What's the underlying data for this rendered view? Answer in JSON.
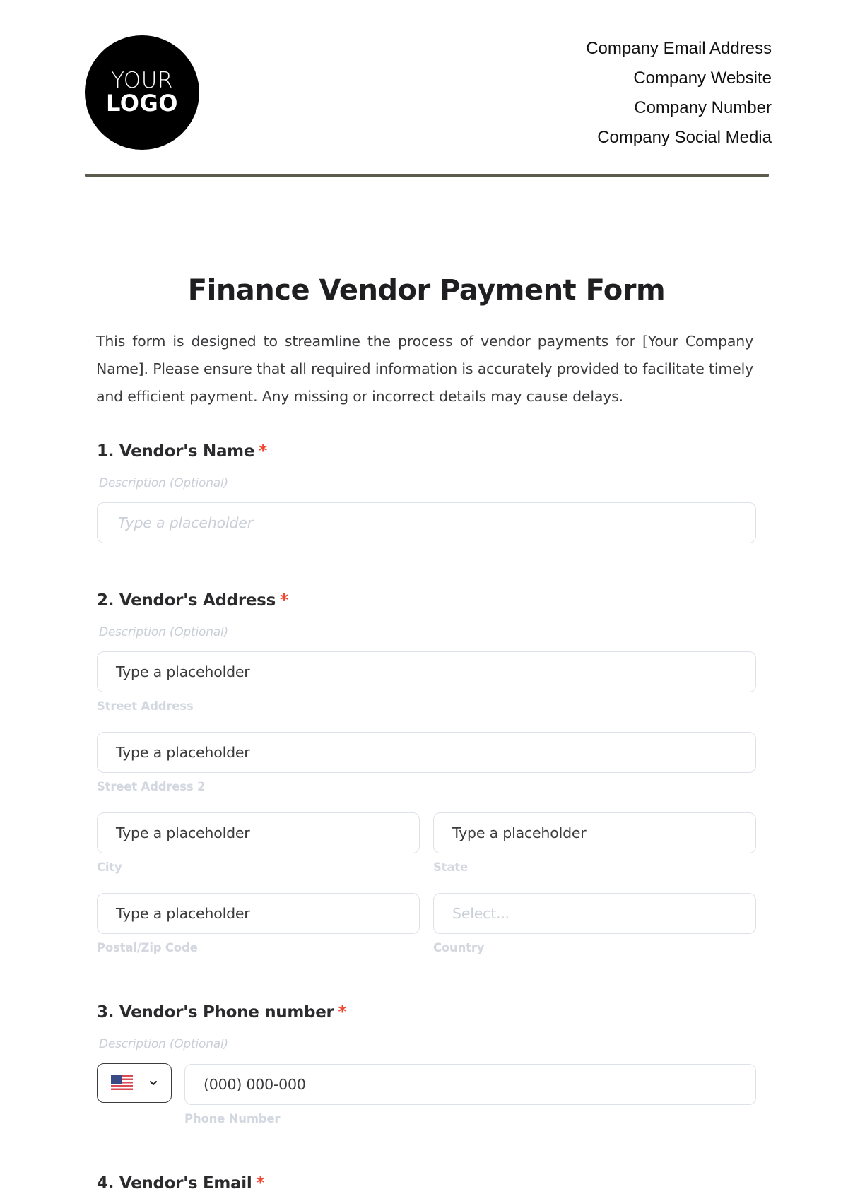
{
  "header": {
    "logo": {
      "line1": "YOUR",
      "line2": "LOGO"
    },
    "contact": [
      "Company Email Address",
      "Company Website",
      "Company Number",
      "Company Social Media"
    ]
  },
  "form": {
    "title": "Finance Vendor Payment Form",
    "intro": "This form is designed to streamline the process of vendor payments for [Your Company Name]. Please ensure that all required information is accurately provided to facilitate timely and efficient payment. Any missing or incorrect details may cause delays.",
    "required_mark": "*",
    "questions": [
      {
        "label": "1. Vendor's Name",
        "description": "Description (Optional)",
        "input_placeholder": "Type a placeholder"
      },
      {
        "label": "2. Vendor's Address",
        "description": "Description (Optional)",
        "fields": [
          {
            "value": "Type a placeholder",
            "sublabel": "Street Address"
          },
          {
            "value": "Type a placeholder",
            "sublabel": "Street Address 2"
          },
          {
            "value": "Type a placeholder",
            "sublabel": "City"
          },
          {
            "value": "Type a placeholder",
            "sublabel": "State"
          },
          {
            "value": "Type a placeholder",
            "sublabel": "Postal/Zip Code"
          },
          {
            "placeholder": "Select...",
            "sublabel": "Country"
          }
        ]
      },
      {
        "label": "3. Vendor's Phone number",
        "description": "Description (Optional)",
        "country_flag": "us-flag",
        "phone_value": "(000) 000-000",
        "sublabel": "Phone Number"
      },
      {
        "label": "4. Vendor's Email"
      }
    ]
  },
  "colors": {
    "required": "#f0442e",
    "divider": "#5c5a4c",
    "field_border": "#dde1e8",
    "muted_text": "#c9ced7"
  }
}
